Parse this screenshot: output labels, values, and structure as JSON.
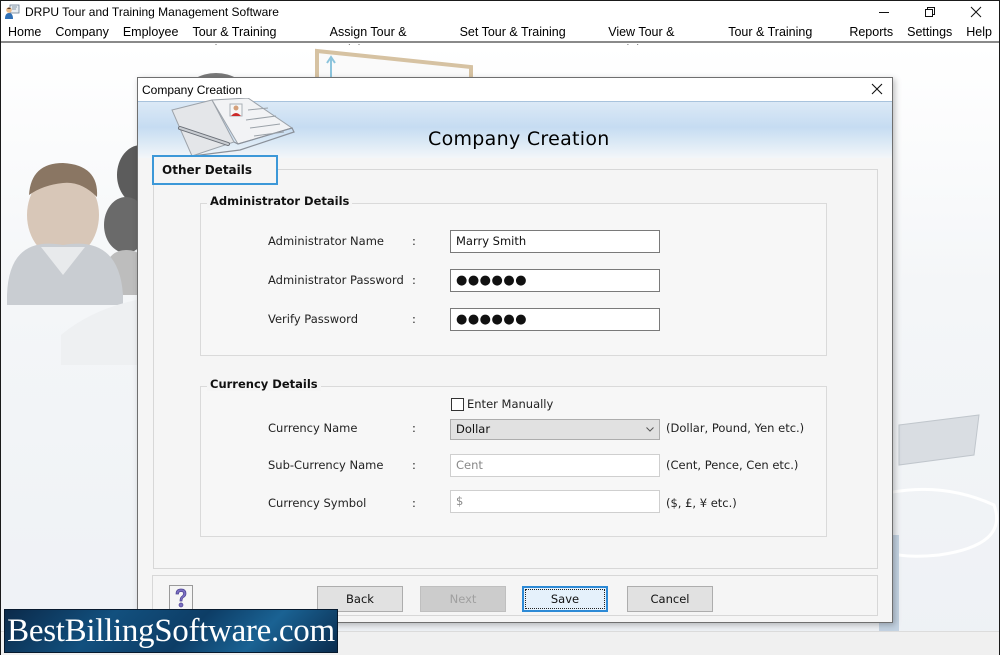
{
  "app": {
    "title": "DRPU Tour and Training Management Software",
    "window_controls": {
      "minimize": "—",
      "restore": "❐",
      "close": "✕"
    }
  },
  "menu": {
    "items": [
      {
        "label": "Home"
      },
      {
        "label": "Company"
      },
      {
        "label": "Employee"
      },
      {
        "label": "Tour & Training Settings"
      },
      {
        "label": "Assign Tour & Training"
      },
      {
        "label": "Set Tour & Training Status"
      },
      {
        "label": "View Tour & Training"
      },
      {
        "label": "Tour & Training Pass"
      },
      {
        "label": "Reports"
      },
      {
        "label": "Settings"
      },
      {
        "label": "Help"
      }
    ]
  },
  "dialog": {
    "window_title": "Company Creation",
    "close_glyph": "✕",
    "banner_title": "Company Creation",
    "section_tab": "Other Details",
    "admin_group": {
      "title": "Administrator Details",
      "fields": [
        {
          "label": "Administrator Name",
          "colon": ":",
          "value": "Marry Smith"
        },
        {
          "label": "Administrator Password",
          "colon": ":",
          "value": "●●●●●●"
        },
        {
          "label": "Verify Password",
          "colon": ":",
          "value": "●●●●●●"
        }
      ]
    },
    "currency_group": {
      "title": "Currency Details",
      "enter_manually": {
        "label": "Enter Manually",
        "checked": false
      },
      "currency_name": {
        "label": "Currency Name",
        "colon": ":",
        "selected": "Dollar",
        "hint": "(Dollar, Pound, Yen etc.)"
      },
      "sub_currency_name": {
        "label": "Sub-Currency Name",
        "colon": ":",
        "value": "Cent",
        "hint": "(Cent, Pence, Cen etc.)"
      },
      "currency_symbol": {
        "label": "Currency Symbol",
        "colon": ":",
        "value": "$",
        "hint": "($, £, ¥ etc.)"
      }
    },
    "buttons": {
      "help": "?",
      "back": "Back",
      "next": "Next",
      "save": "Save",
      "cancel": "Cancel"
    }
  },
  "watermark": {
    "text": "BestBillingSoftware.com"
  },
  "colors": {
    "focus_accent": "#2d8ad6",
    "section_tab_border": "#3c98d8",
    "banner_blue": "#c6dcf2"
  }
}
